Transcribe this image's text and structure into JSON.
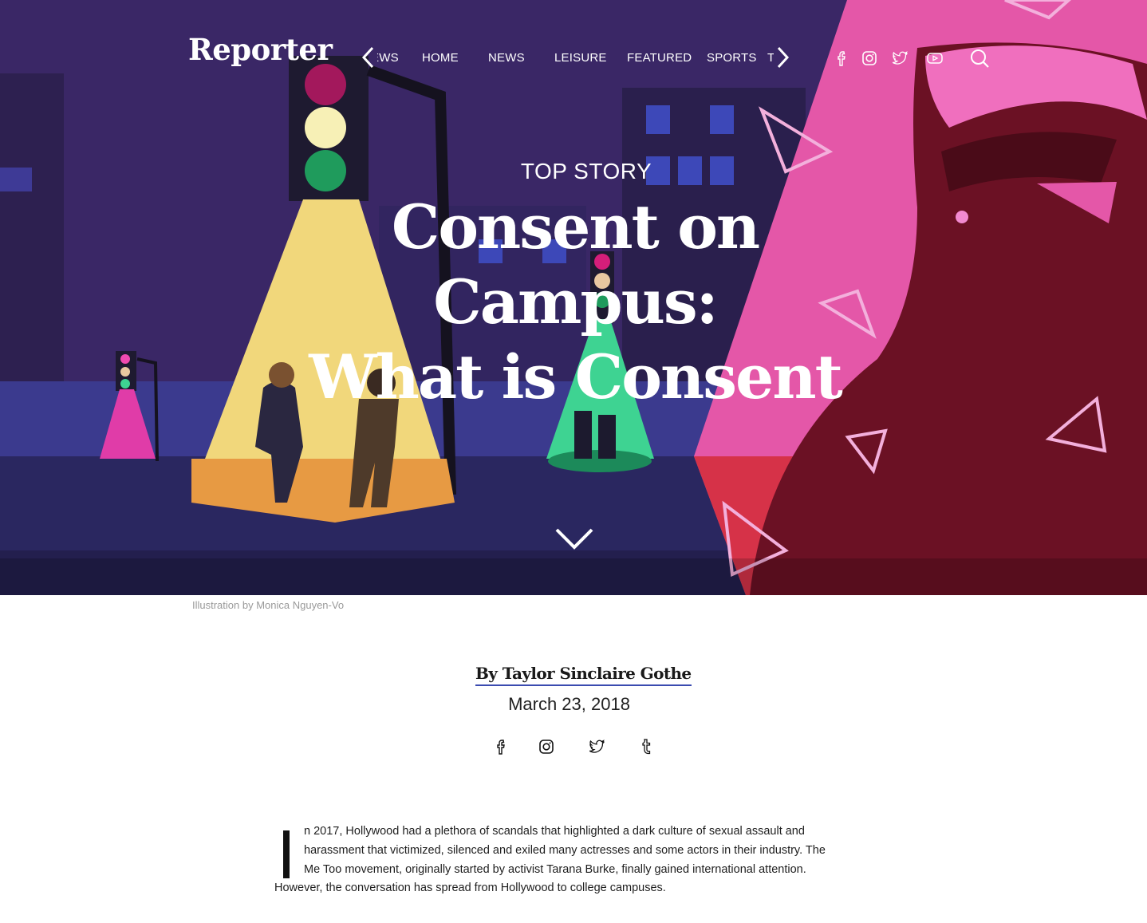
{
  "brand": "Reporter",
  "nav": {
    "prev_label": "previous",
    "next_label": "next",
    "items": [
      "NEWS",
      "HOME",
      "NEWS",
      "LEISURE",
      "FEATURED",
      "SPORTS",
      "TECH"
    ],
    "display_items": [
      "EWS",
      "HOME",
      "NEWS",
      "LEISURE",
      "FEATURED",
      "SPORTS",
      "TE"
    ]
  },
  "social_top": [
    "facebook-icon",
    "instagram-icon",
    "twitter-icon",
    "youtube-icon"
  ],
  "search_icon": "search-icon",
  "hero": {
    "kicker": "TOP STORY",
    "title_lines": [
      "Consent on",
      "Campus:",
      "What is Consent"
    ],
    "scroll_icon": "chevron-down-icon",
    "caption": "Illustration by Monica Nguyen-Vo"
  },
  "article": {
    "byline": "By Taylor Sinclaire Gothe",
    "date": "March 23, 2018",
    "share_icons": [
      "facebook-icon",
      "instagram-icon",
      "twitter-icon",
      "tumblr-icon"
    ],
    "dropcap": "I",
    "paragraph_lines": [
      "n 2017, Hollywood had a plethora of scandals that highlighted a dark culture of sexual assault and",
      "harassment that victimized, silenced and exiled many actresses and some actors in their industry. The",
      "Me Too movement, originally started by activist Tarana Burke, finally gained international attention.",
      "However, the conversation has spread from Hollywood to college campuses."
    ]
  },
  "colors": {
    "night_sky": "#3a2766",
    "pink_panel": "#e457a8",
    "yellow_beam": "#f1d77b",
    "green_beam": "#3ed392",
    "byline_underline": "#3b4bb0",
    "caption_gray": "#9a9a9a"
  }
}
